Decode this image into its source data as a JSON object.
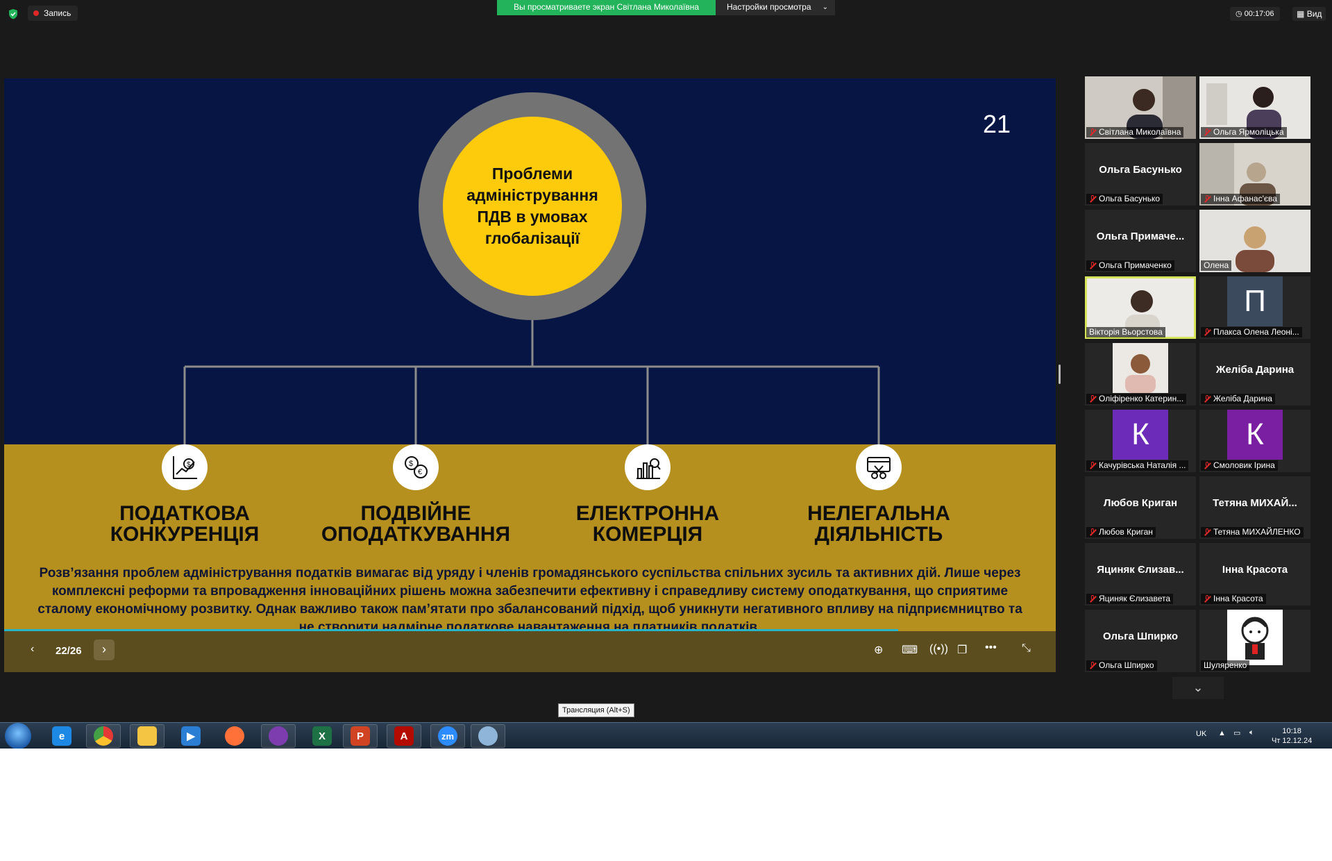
{
  "topbar": {
    "record_label": "Запись",
    "share_banner": "Вы просматриваете экран Світлана Миколаївна",
    "view_options": "Настройки просмотра",
    "timer": "00:17:06",
    "view_label": "Вид"
  },
  "slide": {
    "number": "21",
    "center_title": "Проблеми адміністрування ПДВ в умовах глобалізації",
    "categories": [
      {
        "line1": "Податкова",
        "line2": "конкуренція",
        "icon": "chart-dollar-icon"
      },
      {
        "line1": "Подвійне",
        "line2": "оподаткування",
        "icon": "currency-exchange-icon"
      },
      {
        "line1": "Електронна",
        "line2": "комерція",
        "icon": "analytics-magnifier-icon"
      },
      {
        "line1": "Нелегальна",
        "line2": "діяльність",
        "icon": "card-scissors-icon"
      }
    ],
    "body_text": "Розв’язання проблем адміністрування податків вимагає від уряду і членів громадянського суспільства спільних зусиль та активних дій. Лише через комплексні реформи та впровадження інноваційних рішень можна забезпечити ефективну і справедливу систему оподаткування, що сприятиме сталому економічному розвитку. Однак важливо також пам’ятати про збалансований підхід, щоб уникнути негативного впливу на підприємництво та не створити надмірне податкове навантаження на платників податків.",
    "colors": {
      "navy": "#061543",
      "gold": "#b5901e",
      "yellow": "#fecb0c",
      "ring": "#737373"
    }
  },
  "controls": {
    "page_counter": "22/26",
    "progress": 0.85
  },
  "participants": [
    {
      "name": "Світлана Миколаївна",
      "video": true,
      "muted": true
    },
    {
      "name": "Ольга Ярмоліцька",
      "video": true,
      "muted": true
    },
    {
      "name": "Ольга Басунько",
      "display": "Ольга Басунько",
      "video": false,
      "muted": true
    },
    {
      "name": "Інна Афанас'єва",
      "video": true,
      "muted": true
    },
    {
      "name": "Ольга Примаченко",
      "display": "Ольга  Примаче...",
      "video": false,
      "muted": true
    },
    {
      "name": "Олена",
      "video": true,
      "muted": false
    },
    {
      "name": "Вікторія Вьорстова",
      "video": true,
      "muted": false,
      "active": true
    },
    {
      "name": "Плакса Олена Леоні...",
      "avatar": "П",
      "avatar_color": "#3b4a5c",
      "muted": true
    },
    {
      "name": "Оліфіренко Катерин...",
      "video": true,
      "muted": true
    },
    {
      "name": "Желіба Дарина",
      "display": "Желіба Дарина",
      "video": false,
      "muted": true
    },
    {
      "name": "Качурівська Наталія ...",
      "avatar": "К",
      "avatar_color": "#6c2bb8",
      "muted": true
    },
    {
      "name": "Смоловик Ірина",
      "avatar": "К",
      "avatar_color": "#7b1fa2",
      "muted": true
    },
    {
      "name": "Любов Криган",
      "display": "Любов Криган",
      "video": false,
      "muted": true
    },
    {
      "name": "Тетяна МИХАЙЛЕНКО",
      "display": "Тетяна МИХАЙ...",
      "video": false,
      "muted": true
    },
    {
      "name": "Яциняк Єлизавета",
      "display": "Яциняк Єлизав...",
      "video": false,
      "muted": true
    },
    {
      "name": "Інна Красота",
      "display": "Інна Красота",
      "video": false,
      "muted": true
    },
    {
      "name": "Ольга Шпирко",
      "display": "Ольга Шпирко",
      "video": false,
      "muted": true
    },
    {
      "name": "Шуляренко",
      "image": true,
      "muted": false
    }
  ],
  "tooltip": "Трансляция (Alt+S)",
  "taskbar": {
    "language": "UK",
    "time": "10:18",
    "date": "Чт 12.12.24",
    "apps": [
      {
        "name": "internet-explorer-icon",
        "label": "e",
        "color": "#1e88e5"
      },
      {
        "name": "chrome-icon",
        "label": "",
        "color": "#e53935"
      },
      {
        "name": "explorer-icon",
        "label": "",
        "color": "#f4c542"
      },
      {
        "name": "media-player-icon",
        "label": "",
        "color": "#2a7fd4"
      },
      {
        "name": "firefox-icon",
        "label": "",
        "color": "#ff7139"
      },
      {
        "name": "viber-icon",
        "label": "",
        "color": "#7d3daf"
      },
      {
        "name": "excel-icon",
        "label": "X",
        "color": "#1e7145"
      },
      {
        "name": "powerpoint-icon",
        "label": "P",
        "color": "#d04423"
      },
      {
        "name": "acrobat-icon",
        "label": "A",
        "color": "#b30b00"
      },
      {
        "name": "zoom-icon",
        "label": "zm",
        "color": "#2d8cff"
      },
      {
        "name": "paint-icon",
        "label": "",
        "color": "#8fb6d9"
      }
    ]
  }
}
